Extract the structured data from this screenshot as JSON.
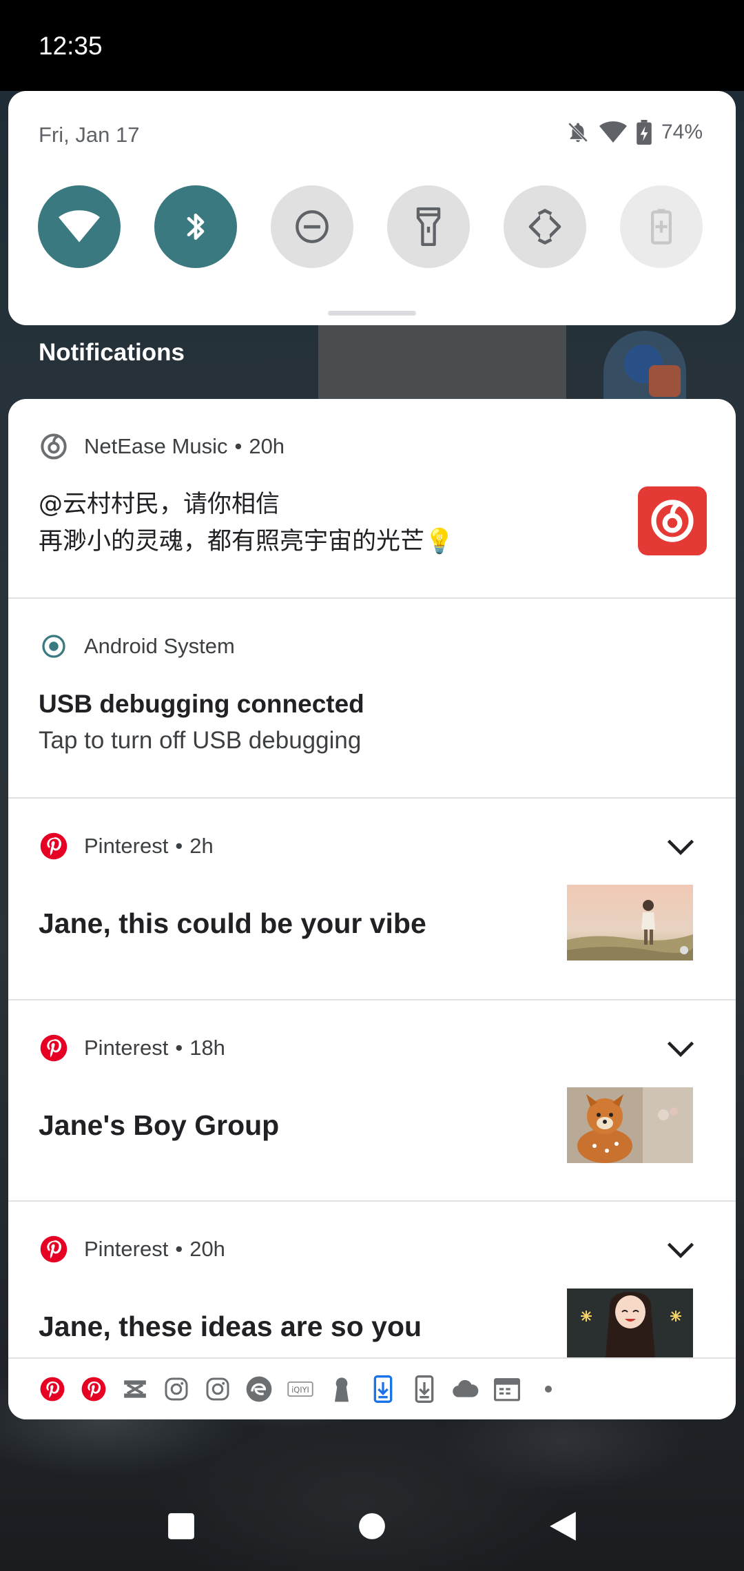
{
  "status_bar": {
    "time": "12:35"
  },
  "quick_settings": {
    "date": "Fri, Jan 17",
    "battery_percent": "74%",
    "tiles": [
      {
        "name": "wifi",
        "state": "on"
      },
      {
        "name": "bluetooth",
        "state": "on"
      },
      {
        "name": "do-not-disturb",
        "state": "off"
      },
      {
        "name": "flashlight",
        "state": "off"
      },
      {
        "name": "auto-rotate",
        "state": "off"
      },
      {
        "name": "battery-saver",
        "state": "unavailable"
      }
    ],
    "colors": {
      "tile_on": "#3b7981",
      "tile_off": "#e0e0e0"
    }
  },
  "notifications_header": "Notifications",
  "notifications": [
    {
      "app": "NetEase Music",
      "time": "20h",
      "line1": "@云村村民，请你相信",
      "line2": "再渺小的灵魂，都有照亮宇宙的光芒💡",
      "icon": "netease-icon",
      "accent": "#e53935"
    },
    {
      "app": "Android System",
      "title": "USB debugging connected",
      "text": "Tap to turn off USB debugging",
      "icon": "android-system-icon"
    },
    {
      "app": "Pinterest",
      "time": "2h",
      "title": "Jane, this could be your vibe",
      "icon": "pinterest-icon",
      "accent": "#e60023"
    },
    {
      "app": "Pinterest",
      "time": "18h",
      "title": "Jane's Boy Group",
      "icon": "pinterest-icon",
      "accent": "#e60023"
    },
    {
      "app": "Pinterest",
      "time": "20h",
      "title": "Jane, these ideas are so you",
      "icon": "pinterest-icon",
      "accent": "#e60023"
    }
  ],
  "footer_icons": [
    "pinterest-icon",
    "pinterest-icon",
    "shuffle-app-icon",
    "instagram-icon",
    "instagram-icon",
    "edge-browser-icon",
    "iqiyi-icon",
    "keyhole-icon",
    "download-blue-icon",
    "download-icon",
    "cloud-icon",
    "calendar-icon",
    "more-dot-icon"
  ],
  "separator": "•"
}
